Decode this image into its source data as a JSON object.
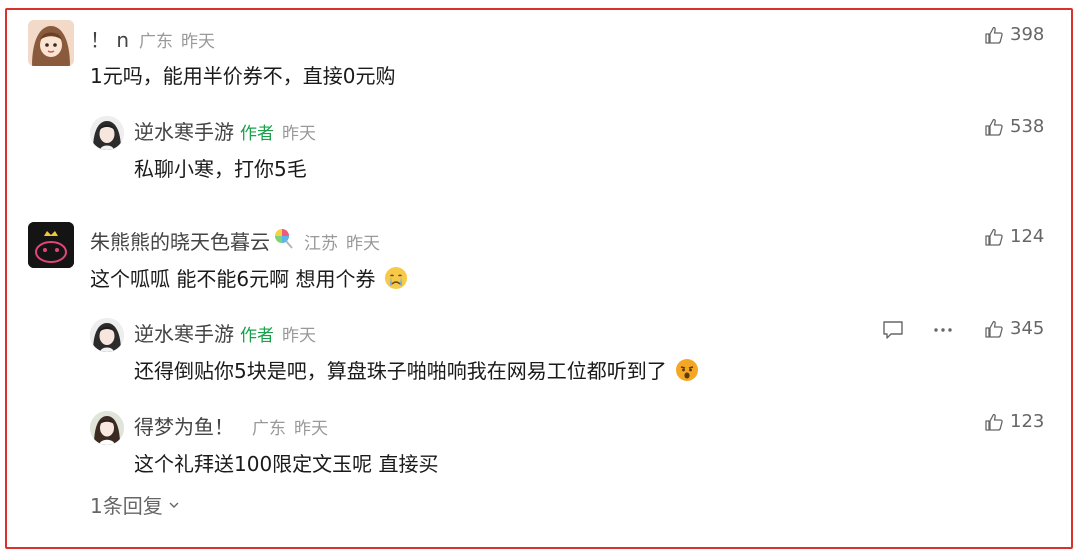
{
  "comments": [
    {
      "user": "！ n",
      "region": "广东",
      "time": "昨天",
      "text": "1元吗，能用半价券不，直接0元购",
      "likes": "398",
      "replies": [
        {
          "user": "逆水寒手游",
          "tag": "作者",
          "time": "昨天",
          "text": "私聊小寒，打你5毛",
          "likes": "538"
        }
      ]
    },
    {
      "user": "朱熊熊的晓天色暮云",
      "region": "江苏",
      "time": "昨天",
      "text": "这个呱呱 能不能6元啊  想用个券",
      "likes": "124",
      "replies": [
        {
          "user": "逆水寒手游",
          "tag": "作者",
          "time": "昨天",
          "text": "还得倒贴你5块是吧，算盘珠子啪啪响我在网易工位都听到了",
          "likes": "345"
        },
        {
          "user": "得梦为鱼！",
          "region": "广东",
          "time": "昨天",
          "text": "这个礼拜送100限定文玉呢 直接买",
          "likes": "123"
        }
      ],
      "more_replies": "1条回复"
    }
  ],
  "icons": {
    "like": "thumbs-up-icon",
    "reply": "comment-bubble-icon",
    "more": "more-dots-icon",
    "expand": "chevron-down-icon"
  },
  "colors": {
    "border": "#d9312b",
    "author_tag": "#19a04b",
    "meta": "#999999"
  }
}
